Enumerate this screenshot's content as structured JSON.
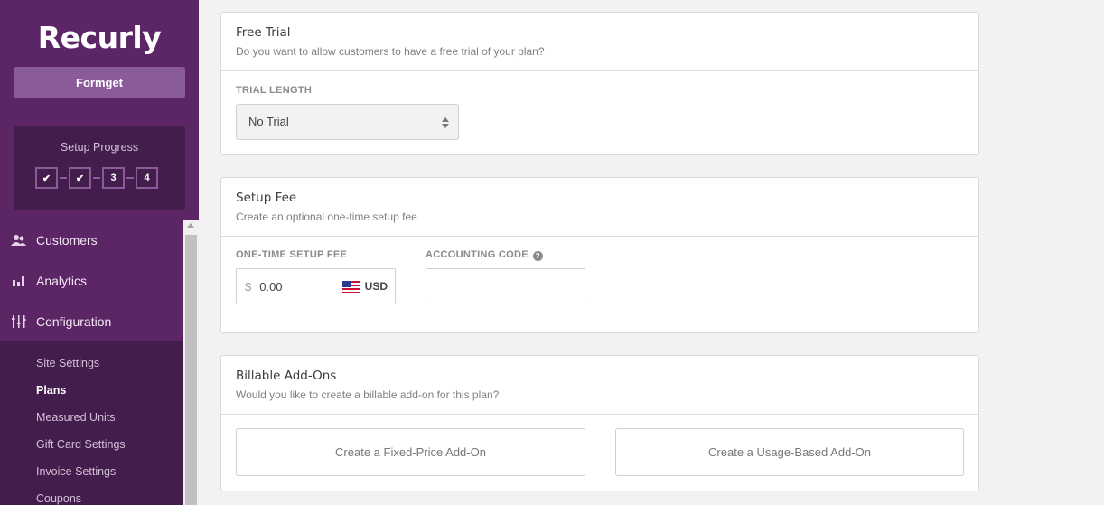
{
  "sidebar": {
    "logo": "Recurly",
    "site_name": "Formget",
    "setup_progress": {
      "title": "Setup Progress",
      "steps": [
        {
          "label": "✔",
          "state": "done"
        },
        {
          "label": "✔",
          "state": "done"
        },
        {
          "label": "3",
          "state": "pending"
        },
        {
          "label": "4",
          "state": "pending"
        }
      ]
    },
    "nav": [
      {
        "label": "Customers",
        "icon": "customers-icon"
      },
      {
        "label": "Analytics",
        "icon": "analytics-icon"
      },
      {
        "label": "Configuration",
        "icon": "configuration-icon"
      }
    ],
    "subnav": [
      {
        "label": "Site Settings",
        "active": false
      },
      {
        "label": "Plans",
        "active": true
      },
      {
        "label": "Measured Units",
        "active": false
      },
      {
        "label": "Gift Card Settings",
        "active": false
      },
      {
        "label": "Invoice Settings",
        "active": false
      },
      {
        "label": "Coupons",
        "active": false
      }
    ]
  },
  "free_trial": {
    "title": "Free Trial",
    "subtitle": "Do you want to allow customers to have a free trial of your plan?",
    "trial_length_label": "TRIAL LENGTH",
    "trial_length_value": "No Trial"
  },
  "setup_fee": {
    "title": "Setup Fee",
    "subtitle": "Create an optional one-time setup fee",
    "fee_label": "ONE-TIME SETUP FEE",
    "currency_symbol": "$",
    "fee_value": "0.00",
    "currency": "USD",
    "accounting_code_label": "ACCOUNTING CODE",
    "accounting_code_value": ""
  },
  "addons": {
    "title": "Billable Add-Ons",
    "subtitle": "Would you like to create a billable add-on for this plan?",
    "fixed_price_button": "Create a Fixed-Price Add-On",
    "usage_based_button": "Create a Usage-Based Add-On"
  }
}
